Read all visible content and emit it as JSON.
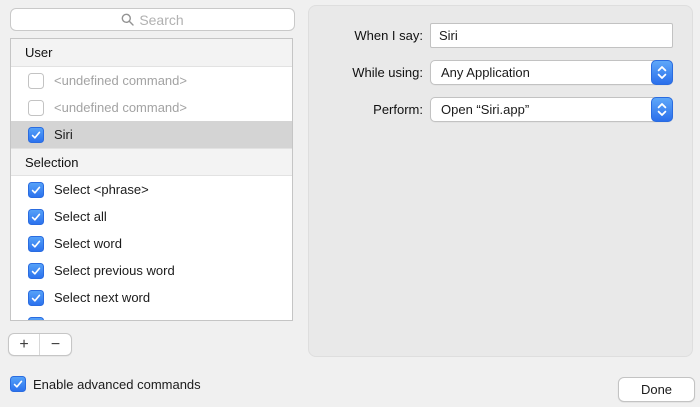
{
  "colors": {
    "accent_blue": "#2c72ee",
    "window_background": "#f0f0f0",
    "panel_background": "#e9e9e9",
    "selected_row": "#d4d4d4"
  },
  "search": {
    "placeholder": "Search"
  },
  "command_list": {
    "sections": [
      {
        "header": "User",
        "items": [
          {
            "label": "<undefined command>",
            "checked": false,
            "muted": true,
            "selected": false
          },
          {
            "label": "<undefined command>",
            "checked": false,
            "muted": true,
            "selected": false
          },
          {
            "label": "Siri",
            "checked": true,
            "muted": false,
            "selected": true
          }
        ]
      },
      {
        "header": "Selection",
        "items": [
          {
            "label": "Select <phrase>",
            "checked": true
          },
          {
            "label": "Select all",
            "checked": true
          },
          {
            "label": "Select word",
            "checked": true
          },
          {
            "label": "Select previous word",
            "checked": true
          },
          {
            "label": "Select next word",
            "checked": true
          },
          {
            "label": "",
            "checked": true,
            "clipped": true
          }
        ]
      }
    ]
  },
  "list_controls": {
    "add_label": "+",
    "remove_label": "−"
  },
  "advanced_checkbox": {
    "label": "Enable advanced commands",
    "checked": true
  },
  "detail_panel": {
    "fields": [
      {
        "label": "When I say:",
        "type": "text",
        "value": "Siri"
      },
      {
        "label": "While using:",
        "type": "select",
        "value": "Any Application"
      },
      {
        "label": "Perform:",
        "type": "select",
        "value": "Open “Siri.app”"
      }
    ]
  },
  "done_button": {
    "label": "Done"
  }
}
